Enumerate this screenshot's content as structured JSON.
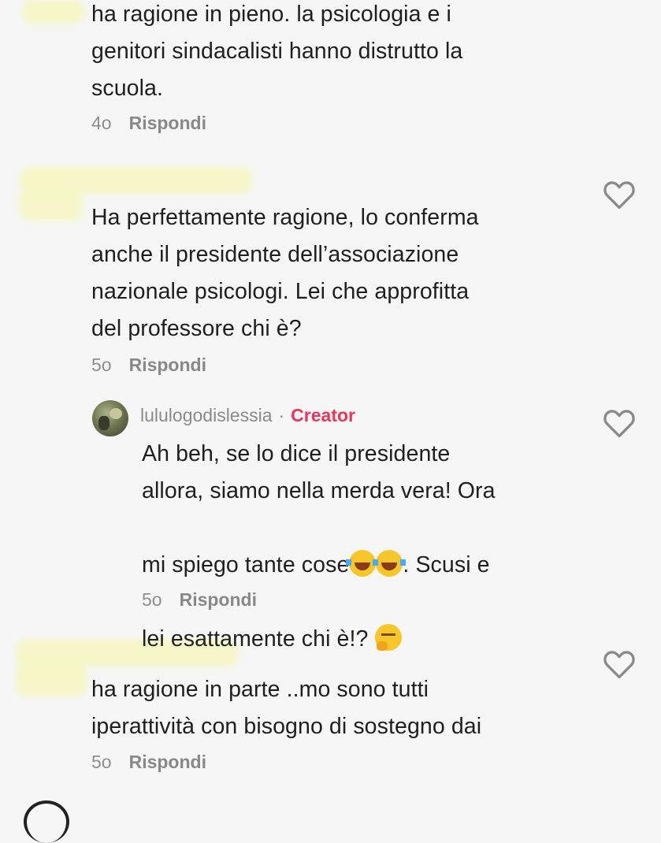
{
  "comments": [
    {
      "text": "ha ragione in pieno. la psicologia e i\ngenitori sindacalisti hanno distrutto la\nscuola.",
      "time": "4o",
      "reply": "Rispondi"
    },
    {
      "text": "Ha perfettamente ragione, lo conferma\nanche il presidente dell’associazione\nnazionale psicologi. Lei che approfitta\ndel professore chi è?",
      "time": "5o",
      "reply": "Rispondi"
    },
    {
      "username": "lululogodislessia",
      "separator": "·",
      "badge": "Creator",
      "line1": "Ah beh, se lo dice il presidente",
      "line2": "allora, siamo nella merda vera! Ora",
      "line3_pre": "mi spiego tante cose",
      "line3_post": ". Scusi e",
      "line4_pre": "lei esattamente chi è!? ",
      "time": "5o",
      "reply": "Rispondi"
    },
    {
      "text": "ha ragione in parte ..mo sono tutti\niperattività con bisogno di sostegno dai",
      "time": "5o",
      "reply": "Rispondi"
    }
  ],
  "colors": {
    "background": "#f6f6f6",
    "creator_badge": "#e8355a",
    "meta_text": "#8e8e8e",
    "heart_outline": "#8a8a8a"
  },
  "icons": {
    "like": "heart-outline-icon",
    "laugh_emoji": "face-with-tears-of-joy",
    "think_emoji": "thinking-face"
  }
}
